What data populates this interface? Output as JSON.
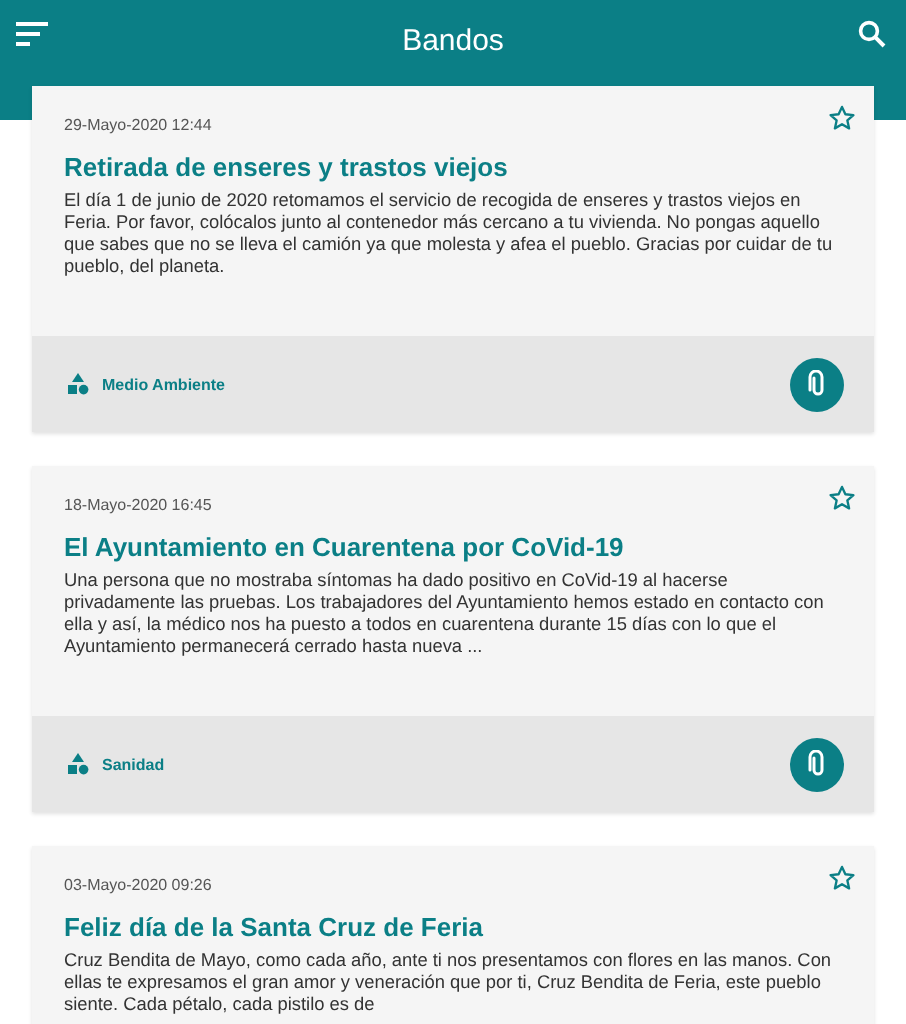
{
  "app_bar": {
    "title": "Bandos"
  },
  "notices": [
    {
      "date": "29-Mayo-2020 12:44",
      "title": "Retirada de enseres y trastos viejos",
      "body": "El día 1 de junio de 2020 retomamos el servicio de recogida de enseres y trastos viejos en Feria. Por favor, colócalos junto al contenedor más cercano a tu vivienda. No pongas aquello que sabes que no se lleva el camión ya que molesta y afea el pueblo. Gracias por cuidar de tu pueblo, del planeta.",
      "favorite": false,
      "category": "Medio Ambiente"
    },
    {
      "date": "18-Mayo-2020 16:45",
      "title": "El Ayuntamiento en Cuarentena por CoVid-19",
      "body": "Una persona que no mostraba síntomas ha dado positivo en CoVid-19 al hacerse privadamente las pruebas. Los trabajadores del Ayuntamiento hemos estado en contacto con ella y así, la médico nos ha puesto a todos en cuarentena durante 15 días con lo que el Ayuntamiento permanecerá cerrado hasta nueva ...",
      "favorite": false,
      "category": "Sanidad"
    },
    {
      "date": "03-Mayo-2020 09:26",
      "title": "Feliz día de la Santa Cruz de Feria",
      "body": "Cruz Bendita de Mayo, como cada año, ante ti nos presentamos con flores en las manos. Con ellas te expresamos el gran amor y veneración que por ti, Cruz Bendita de Feria, este pueblo siente. Cada pétalo, cada pistilo es de",
      "favorite": false
    }
  ]
}
